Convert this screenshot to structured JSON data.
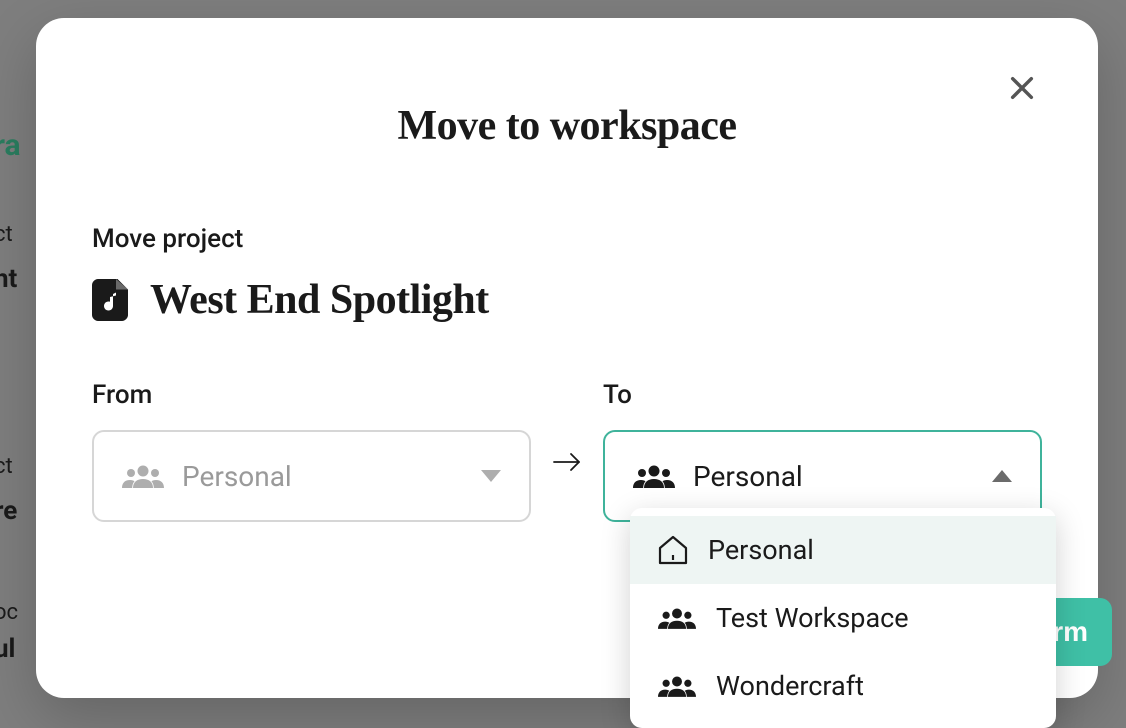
{
  "modal": {
    "title": "Move to workspace",
    "section_label": "Move project",
    "project_name": "West End Spotlight",
    "from_label": "From",
    "to_label": "To",
    "from_value": "Personal",
    "to_value": "Personal",
    "confirm_label": "rm"
  },
  "dropdown": {
    "options": [
      {
        "label": "Personal",
        "icon": "house"
      },
      {
        "label": "Test Workspace",
        "icon": "people"
      },
      {
        "label": "Wondercraft",
        "icon": "people"
      }
    ]
  },
  "background": {
    "hint1": "ra",
    "hint2": "ct",
    "hint3": "ht",
    "hint4": "ct",
    "hint5": "re",
    "hint6": "oc",
    "hint7": "ul"
  }
}
